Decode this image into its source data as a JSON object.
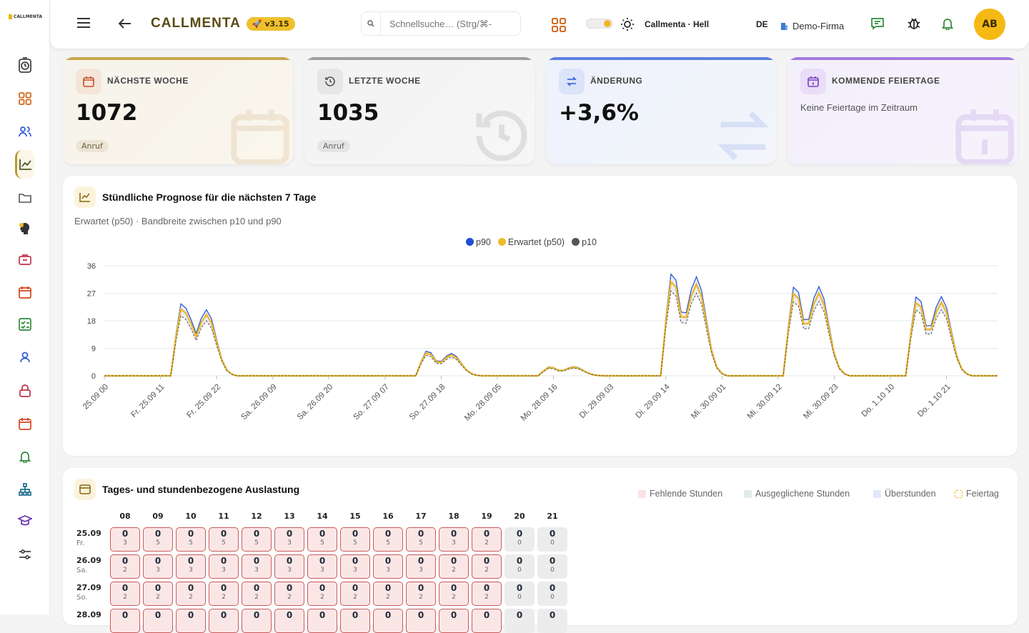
{
  "app": {
    "logo_text": "CALLMENTA",
    "brand": "CALLMENTA",
    "version": "v3.15"
  },
  "search": {
    "placeholder": "Schnellsuche… (Strg/⌘-"
  },
  "theme": {
    "label": "Callmenta · Hell"
  },
  "lang": "DE",
  "company": "Demo-Firma",
  "avatar": "AB",
  "sidebar": {
    "items": [
      {
        "icon": "stopwatch-icon"
      },
      {
        "icon": "grid-icon"
      },
      {
        "icon": "users-icon"
      },
      {
        "icon": "chart-icon",
        "active": true
      },
      {
        "icon": "folder-icon"
      },
      {
        "icon": "ai-head-icon"
      },
      {
        "icon": "briefcase-icon"
      },
      {
        "icon": "calendar-icon"
      },
      {
        "icon": "checklist-icon"
      },
      {
        "icon": "user-icon"
      },
      {
        "icon": "lock-icon"
      },
      {
        "icon": "calendar-alt-icon"
      },
      {
        "icon": "bell-icon"
      },
      {
        "icon": "sitemap-icon"
      },
      {
        "icon": "graduation-icon"
      },
      {
        "icon": "sliders-icon"
      }
    ]
  },
  "kpis": [
    {
      "label": "NÄCHSTE WOCHE",
      "value": "1072",
      "tag": "Anruf",
      "accent": "#c9a84b"
    },
    {
      "label": "LETZTE WOCHE",
      "value": "1035",
      "tag": "Anruf",
      "accent": "#9e9e9e"
    },
    {
      "label": "ÄNDERUNG",
      "value": "+3,6%",
      "accent": "#5b7fe0"
    },
    {
      "label": "KOMMENDE FEIERTAGE",
      "text": "Keine Feiertage im Zeitraum",
      "accent": "#a37be0"
    }
  ],
  "forecast": {
    "title": "Stündliche Prognose für die nächsten 7 Tage",
    "subtitle": "Erwartet (p50) · Bandbreite zwischen p10 und p90"
  },
  "chart_data": {
    "type": "line",
    "series": [
      {
        "name": "p90",
        "color": "#1e4fd6"
      },
      {
        "name": "Erwartet (p50)",
        "color": "#f0b92a"
      },
      {
        "name": "p10",
        "color": "#555555"
      }
    ],
    "x_tick_labels": [
      "25.09 00",
      "Fr. 25.09 11",
      "Fr. 25.09 22",
      "Sa. 26.09 09",
      "Sa. 26.09 20",
      "So. 27.09 07",
      "So. 27.09 18",
      "Mo. 28.09 05",
      "Mo. 28.09 16",
      "Di. 29.09 03",
      "Di. 29.09 14",
      "Mi. 30.09 01",
      "Mi. 30.09 12",
      "Mi. 30.09 23",
      "Do. 1.10 10",
      "Do. 1.10 21"
    ],
    "y_ticks": [
      0,
      9,
      18,
      27,
      36
    ],
    "ylim": [
      0,
      36
    ],
    "hours": 176,
    "days": [
      {
        "start": 13,
        "peak1": 22,
        "mid": 17,
        "peak2": 20
      },
      {
        "start": 61,
        "peak1": 7.5,
        "mid": 4.5,
        "peak2": 6.8
      },
      {
        "start": 85,
        "peak1": 2.7,
        "mid": 1.5,
        "peak2": 2.8
      },
      {
        "start": 109,
        "peak1": 31,
        "mid": 15,
        "peak2": 30
      },
      {
        "start": 133,
        "peak1": 27,
        "mid": 12,
        "peak2": 27
      },
      {
        "start": 157,
        "peak1": 24,
        "mid": 12,
        "peak2": 24
      }
    ],
    "grid": true,
    "legend": "top-center"
  },
  "utilization": {
    "title": "Tages- und stundenbezogene Auslastung",
    "legend": [
      {
        "label": "Fehlende Stunden",
        "color": "#fbe1e4"
      },
      {
        "label": "Ausgeglichene Stunden",
        "color": "#dfeee6"
      },
      {
        "label": "Überstunden",
        "color": "#e2e7fb"
      },
      {
        "label": "Feiertag",
        "color": "#f0b92a"
      }
    ],
    "hours": [
      "08",
      "09",
      "10",
      "11",
      "12",
      "13",
      "14",
      "15",
      "16",
      "17",
      "18",
      "19",
      "20",
      "21"
    ],
    "rows": [
      {
        "date": "25.09",
        "day": "Fr.",
        "top": [
          "0",
          "0",
          "0",
          "0",
          "0",
          "0",
          "0",
          "0",
          "0",
          "0",
          "0",
          "0",
          "0",
          "0"
        ],
        "sub": [
          "3",
          "5",
          "5",
          "5",
          "5",
          "3",
          "5",
          "5",
          "5",
          "5",
          "3",
          "2",
          "0",
          "0"
        ]
      },
      {
        "date": "26.09",
        "day": "Sa.",
        "top": [
          "0",
          "0",
          "0",
          "0",
          "0",
          "0",
          "0",
          "0",
          "0",
          "0",
          "0",
          "0",
          "0",
          "0"
        ],
        "sub": [
          "2",
          "3",
          "3",
          "3",
          "3",
          "3",
          "3",
          "3",
          "3",
          "3",
          "2",
          "2",
          "0",
          "0"
        ]
      },
      {
        "date": "27.09",
        "day": "So.",
        "top": [
          "0",
          "0",
          "0",
          "0",
          "0",
          "0",
          "0",
          "0",
          "0",
          "0",
          "0",
          "0",
          "0",
          "0"
        ],
        "sub": [
          "2",
          "2",
          "2",
          "2",
          "2",
          "2",
          "2",
          "2",
          "2",
          "2",
          "2",
          "2",
          "0",
          "0"
        ]
      },
      {
        "date": "28.09",
        "day": "",
        "top": [
          "0",
          "0",
          "0",
          "0",
          "0",
          "0",
          "0",
          "0",
          "0",
          "0",
          "0",
          "0",
          "0",
          "0"
        ],
        "sub": [
          "",
          "",
          "",
          "",
          "",
          "",
          "",
          "",
          "",
          "",
          "",
          "",
          "",
          ""
        ]
      }
    ]
  }
}
